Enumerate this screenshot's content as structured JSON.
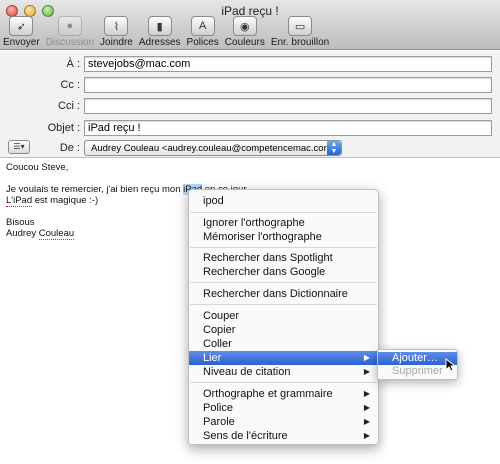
{
  "window": {
    "title": "iPad reçu !"
  },
  "toolbar": [
    {
      "label": "Envoyer",
      "icon": "send-icon",
      "glyph": "➶",
      "enabled": true
    },
    {
      "label": "Discussion",
      "icon": "chat-icon",
      "glyph": "●",
      "enabled": false
    },
    {
      "label": "Joindre",
      "icon": "paperclip-icon",
      "glyph": "⌇",
      "enabled": true
    },
    {
      "label": "Adresses",
      "icon": "address-book-icon",
      "glyph": "▮",
      "enabled": true
    },
    {
      "label": "Polices",
      "icon": "fonts-icon",
      "glyph": "A",
      "enabled": true
    },
    {
      "label": "Couleurs",
      "icon": "color-wheel-icon",
      "glyph": "◉",
      "enabled": true
    },
    {
      "label": "Enr. brouillon",
      "icon": "save-draft-icon",
      "glyph": "▭",
      "enabled": true
    }
  ],
  "headers": {
    "to_label": "À :",
    "to_value": "stevejobs@mac.com",
    "cc_label": "Cc :",
    "cc_value": "",
    "bcc_label": "Cci :",
    "bcc_value": "",
    "subject_label": "Objet :",
    "subject_value": "iPad reçu !",
    "from_label": "De :",
    "from_value": "Audrey Couleau <audrey.couleau@competencemac.com>",
    "options_glyph": "☰▾"
  },
  "body": {
    "greeting": "Coucou Steve,",
    "line1_before": "Je voulais te remercier, j'ai bien reçu mon ",
    "line1_selected": "iPad",
    "line1_after": " en ce jour.",
    "line2_word": "L'iPad",
    "line2_rest": " est magique :-)",
    "closing": "Bisous",
    "sig_first": "Audrey ",
    "sig_last": "Couleau"
  },
  "context_menu": {
    "suggestion": "ipod",
    "ignore": "Ignorer l'orthographe",
    "learn": "Mémoriser l'orthographe",
    "search_spotlight": "Rechercher dans Spotlight",
    "search_google": "Rechercher dans Google",
    "search_dictionary": "Rechercher dans Dictionnaire",
    "cut": "Couper",
    "copy": "Copier",
    "paste": "Coller",
    "link": "Lier",
    "quote_level": "Niveau de citation",
    "spelling_grammar": "Orthographe et grammaire",
    "font": "Police",
    "speech": "Parole",
    "writing_direction": "Sens de l'écriture",
    "arrow": "▶"
  },
  "submenu": {
    "add": "Ajouter…",
    "remove": "Supprimer"
  }
}
